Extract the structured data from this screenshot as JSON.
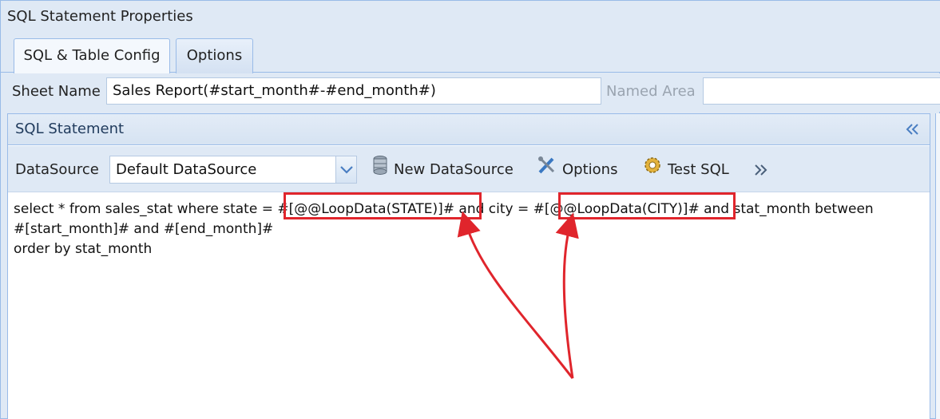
{
  "window": {
    "title": "SQL Statement Properties"
  },
  "tabs": [
    {
      "label": "SQL & Table Config",
      "active": true
    },
    {
      "label": "Options",
      "active": false
    }
  ],
  "form": {
    "sheet_name_label": "Sheet Name",
    "sheet_name_value": "Sales Report(#start_month#-#end_month#)",
    "named_area_label": "Named Area",
    "named_area_value": ""
  },
  "panel": {
    "title": "SQL Statement"
  },
  "toolbar": {
    "datasource_label": "DataSource",
    "datasource_value": "Default DataSource",
    "new_datasource_label": "New DataSource",
    "options_label": "Options",
    "test_sql_label": "Test SQL"
  },
  "editor": {
    "line1_a": "select * from sales_stat where state = ",
    "line1_b": "#[@@LoopData(STATE)]#",
    "line1_c": " and city = ",
    "line1_d": "#[@@LoopData(CITY)]#",
    "line1_e": " and stat_month between",
    "line2": "#[start_month]# and #[end_month]#",
    "line3": "order by stat_month"
  },
  "colors": {
    "highlight": "#e0252c",
    "accent": "#4a7ec2",
    "border": "#99bbe8"
  },
  "icons": {
    "collapse": "double-chevron-left-icon",
    "datasource_dropdown": "chevron-down-icon",
    "new_datasource": "database-icon",
    "options": "tools-icon",
    "test_sql": "gear-icon",
    "overflow": "double-chevron-right-icon"
  }
}
